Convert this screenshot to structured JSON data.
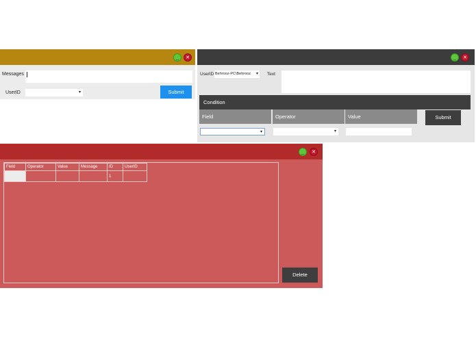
{
  "messages_window": {
    "minimize_label": "_",
    "close_label": "✕",
    "messages_label": "Messages",
    "messages_value": "",
    "userid_label": "UserID",
    "userid_value": "",
    "dropdown_glyph": "▾",
    "submit_label": "Submit",
    "title_color": "#b58610",
    "submit_color": "#1e90ee"
  },
  "query_window": {
    "minimize_label": "_",
    "close_label": "✕",
    "userid_label": "UserID",
    "userid_value": "Behrooz-PC\\Behrooz",
    "dropdown_glyph": "▾",
    "text_label": "Text",
    "text_value": "",
    "condition_label": "Condition",
    "columns": [
      "Field",
      "Operator",
      "Value"
    ],
    "field_value": "",
    "operator_value": "",
    "value_value": "",
    "submit_label": "Submit",
    "title_color": "#3c3c3c"
  },
  "records_window": {
    "minimize_label": "_",
    "close_label": "✕",
    "columns": [
      "Field",
      "Operator",
      "Value",
      "Message",
      "ID",
      "UserID"
    ],
    "rows": [
      [
        "",
        "",
        "",
        "",
        "1",
        ""
      ]
    ],
    "delete_label": "Delete",
    "title_color": "#b32a2a",
    "body_color": "#cc5a5a"
  }
}
